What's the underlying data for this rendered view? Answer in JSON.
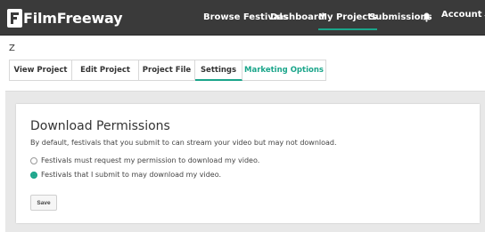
{
  "nav": {
    "logo_text": "FilmFreeway",
    "links": [
      "Browse Festivals",
      "Dashboard",
      "My Projects",
      "Submissions"
    ],
    "active": "My Projects",
    "bell_icon": "bell-icon",
    "account_label": "Account",
    "accent_color": "#1aa58a",
    "bg_color": "#3a3a3a"
  },
  "project": {
    "title": "Z"
  },
  "tabs": [
    "View Project",
    "Edit Project",
    "Project File",
    "Settings",
    "Marketing Options"
  ],
  "active_tab": "Settings",
  "permissions": {
    "heading": "Download Permissions",
    "description": "By default, festivals that you submit to can stream your video but may not download.",
    "options": [
      {
        "label": "Festivals must request my permission to download my video.",
        "selected": false
      },
      {
        "label": "Festivals that I submit to may download my video.",
        "selected": true
      }
    ],
    "save_label": "Save"
  }
}
